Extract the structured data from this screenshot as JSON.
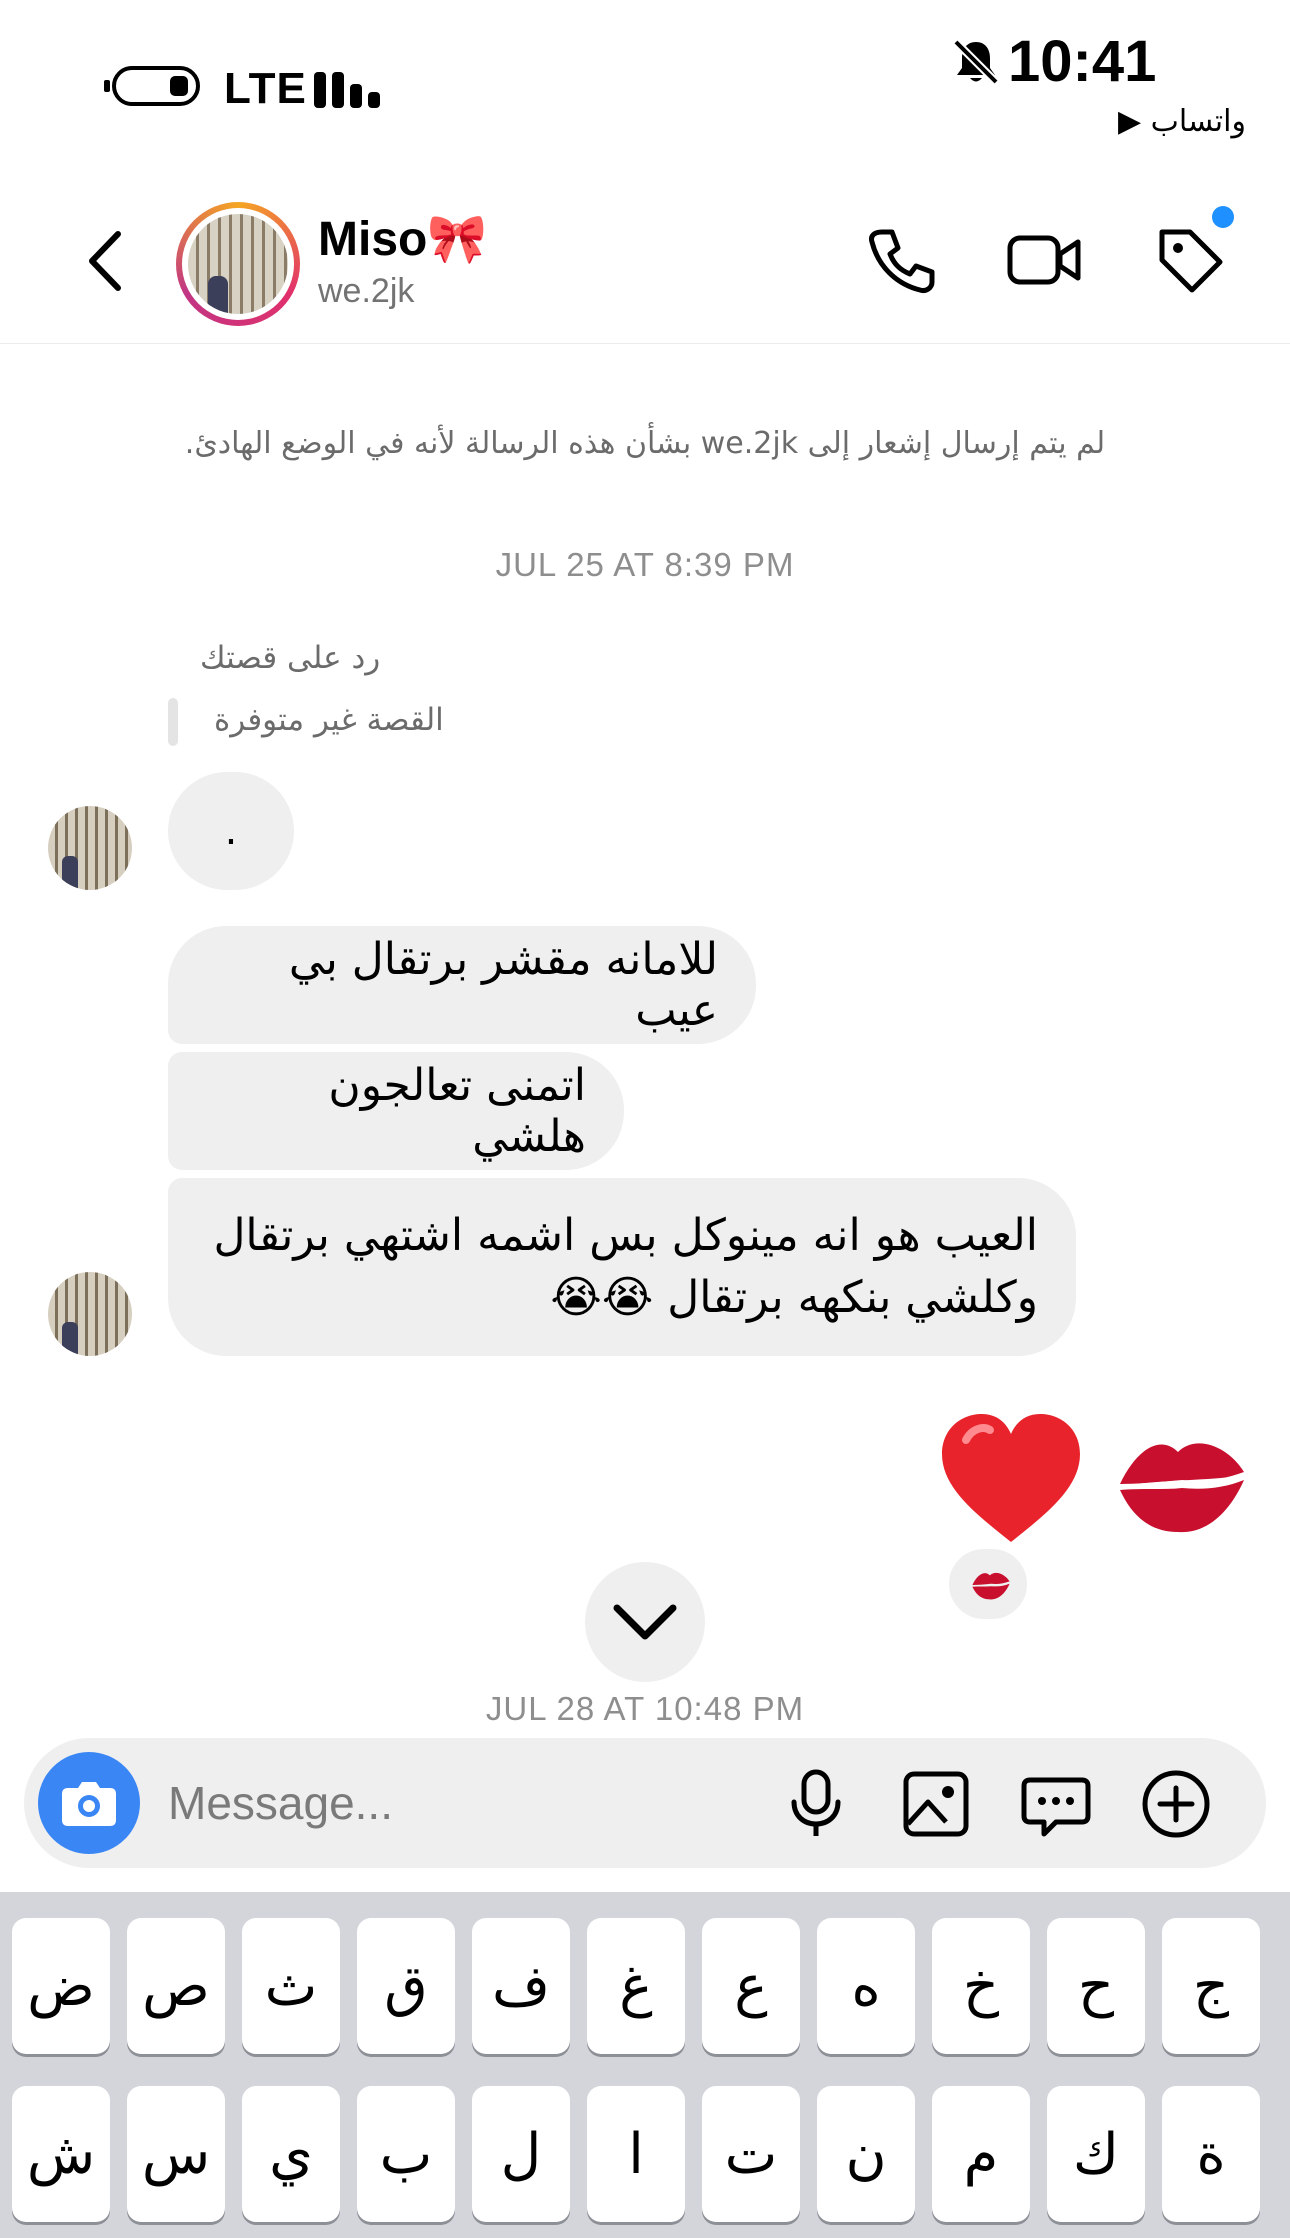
{
  "status_bar": {
    "network": "LTE",
    "time": "10:41",
    "back_app": "واتساب ▶",
    "icons": [
      "low-power-toggle-icon",
      "signal-icon",
      "silent-bell-icon"
    ]
  },
  "header": {
    "name": "Miso🎀",
    "username": "we.2jk",
    "icons": [
      "back-icon",
      "phone-icon",
      "video-icon",
      "tag-icon"
    ],
    "accent_dot_color": "#1e90ff"
  },
  "chat": {
    "notice": "لم يتم إرسال إشعار إلى we.2jk بشأن هذه الرسالة لأنه في الوضع الهادئ.",
    "timestamp_1": "JUL 25 AT 8:39 PM",
    "reply_label": "رد على قصتك",
    "story_unavailable": "القصة غير متوفرة",
    "dot_message": ".",
    "messages": [
      "للامانه مقشر برتقال بي عيب",
      "اتمنى تعالجون هلشي",
      "العيب هو انه مينوكل بس اشمه اشتهي برتقال وكلشي بنكهه برتقال 😭😭"
    ],
    "sent_emojis": [
      "❤️",
      "💋"
    ],
    "reaction": "💋",
    "timestamp_2": "JUL 28 AT 10:48 PM"
  },
  "composer": {
    "placeholder": "Message...",
    "icons": [
      "camera-icon",
      "microphone-icon",
      "gallery-icon",
      "sticker-icon",
      "add-icon"
    ],
    "camera_color": "#3a86f5"
  },
  "keyboard": {
    "row1": [
      "ض",
      "ص",
      "ث",
      "ق",
      "ف",
      "غ",
      "ع",
      "ه",
      "خ",
      "ح",
      "ج"
    ],
    "row2": [
      "ش",
      "س",
      "ي",
      "ب",
      "ل",
      "ا",
      "ت",
      "ن",
      "م",
      "ك",
      "ة"
    ]
  }
}
